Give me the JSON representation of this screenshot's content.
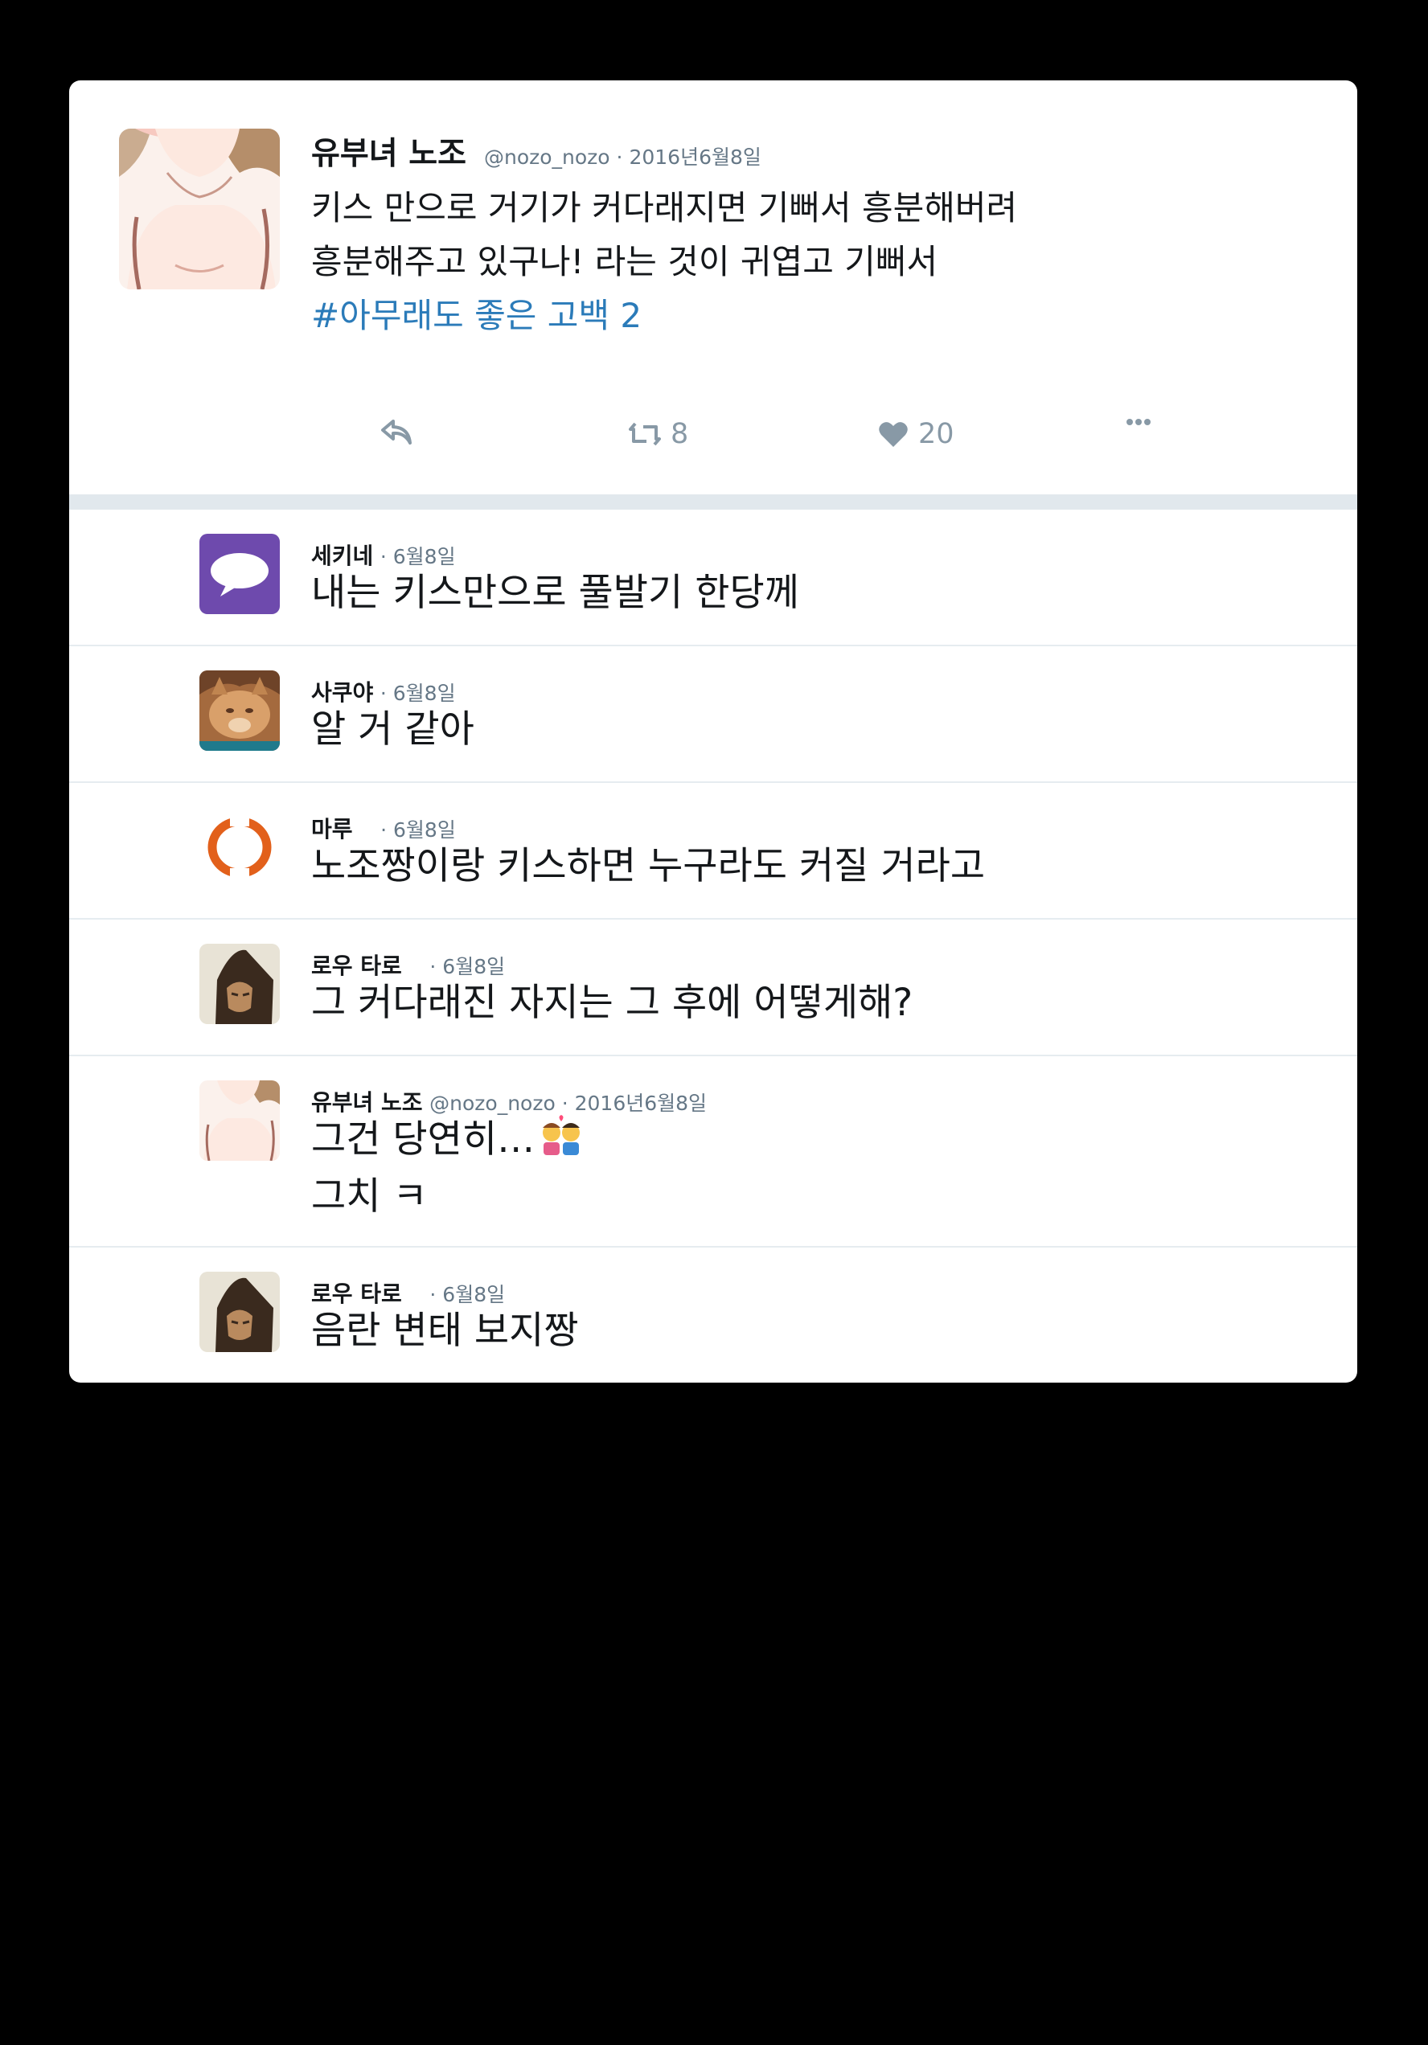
{
  "main_tweet": {
    "display_name": "유부녀 노조",
    "handle_date": "@nozo_nozo · 2016년6월8일",
    "lines": [
      "키스 만으로 거기가 커다래지면 기뻐서 흥분해버려",
      "흥분해주고 있구나! 라는 것이 귀엽고 기뻐서"
    ],
    "hashtag": "#아무래도 좋은 고백 2",
    "actions": {
      "reply_icon": "reply-icon",
      "retweet_icon": "retweet-icon",
      "retweet_count": "8",
      "like_icon": "heart-icon",
      "like_count": "20",
      "more_icon": "more-icon"
    }
  },
  "replies": [
    {
      "name": "세키네",
      "meta": "· 6월8일",
      "lines": [
        "내는 키스만으로 풀발기 한당께"
      ]
    },
    {
      "name": "사쿠야",
      "meta": "· 6월8일",
      "lines": [
        "알 거 같아"
      ]
    },
    {
      "name": "마루",
      "meta": "· 6월8일",
      "lines": [
        "노조짱이랑 키스하면 누구라도 커질 거라고"
      ]
    },
    {
      "name": "로우 타로",
      "meta": "· 6월8일",
      "lines": [
        "그 커다래진 자지는 그 후에 어떻게해?"
      ]
    },
    {
      "name": "유부녀 노조",
      "meta": "@nozo_nozo · 2016년6월8일",
      "lines": [
        "그건 당연히…",
        "그치 ㅋ"
      ],
      "emoji": "kissing-couple-emoji"
    },
    {
      "name": "로우 타로",
      "meta": "· 6월8일",
      "lines": [
        "음란 변태 보지짱"
      ]
    }
  ],
  "colors": {
    "hashtag": "#2b7bb9",
    "meta_gray": "#657786",
    "action_gray": "#8899a6",
    "divider": "#e1e8ed",
    "chat_avatar_purple": "#6e4aad",
    "ring_avatar_orange": "#e2601b"
  }
}
